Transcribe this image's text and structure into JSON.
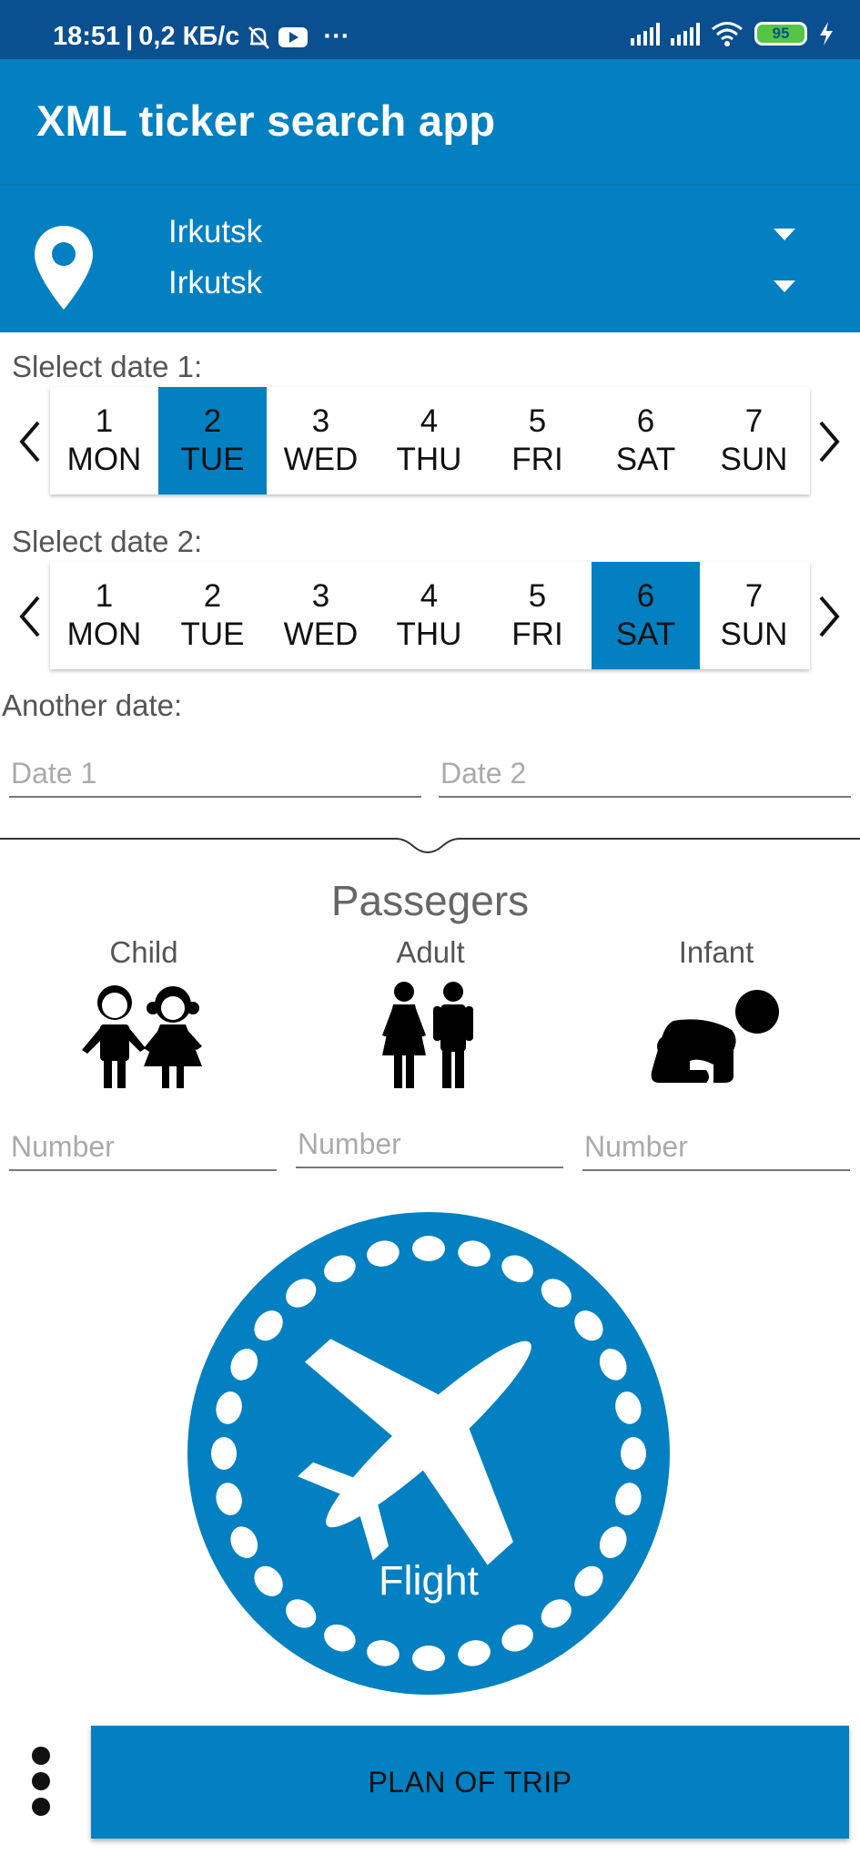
{
  "status_bar": {
    "time": "18:51",
    "network_speed": "0,2 КБ/с",
    "more": "···",
    "battery": "95",
    "icons": [
      "mute-bell-icon",
      "youtube-icon",
      "signal-icon",
      "signal-icon",
      "wifi-icon",
      "battery-icon",
      "charging-bolt-icon"
    ]
  },
  "app_bar": {
    "title": "XML ticker search app"
  },
  "cities": {
    "from": "Irkutsk",
    "to": "Irkutsk",
    "icon": "location-pin-icon"
  },
  "date_picker_1": {
    "label": "Slelect date 1:",
    "selected_index": 1,
    "days": [
      {
        "num": "1",
        "name": "MON"
      },
      {
        "num": "2",
        "name": "TUE"
      },
      {
        "num": "3",
        "name": "WED"
      },
      {
        "num": "4",
        "name": "THU"
      },
      {
        "num": "5",
        "name": "FRI"
      },
      {
        "num": "6",
        "name": "SAT"
      },
      {
        "num": "7",
        "name": "SUN"
      }
    ]
  },
  "date_picker_2": {
    "label": "Slelect date 2:",
    "selected_index": 5,
    "days": [
      {
        "num": "1",
        "name": "MON"
      },
      {
        "num": "2",
        "name": "TUE"
      },
      {
        "num": "3",
        "name": "WED"
      },
      {
        "num": "4",
        "name": "THU"
      },
      {
        "num": "5",
        "name": "FRI"
      },
      {
        "num": "6",
        "name": "SAT"
      },
      {
        "num": "7",
        "name": "SUN"
      }
    ]
  },
  "another_date": {
    "label": "Another date:",
    "date1_placeholder": "Date 1",
    "date2_placeholder": "Date 2"
  },
  "passengers": {
    "title": "Passegers",
    "child_label": "Child",
    "adult_label": "Adult",
    "infant_label": "Infant",
    "child_placeholder": "Number",
    "adult_placeholder": "Number",
    "infant_placeholder": "Number"
  },
  "flight_button": {
    "label": "Flight",
    "icon": "airplane-icon"
  },
  "plan_button": {
    "label": "PLAN OF TRIP"
  },
  "colors": {
    "primary": "#0280c1",
    "status_bar": "#0a4f8f",
    "battery": "#55c545"
  }
}
